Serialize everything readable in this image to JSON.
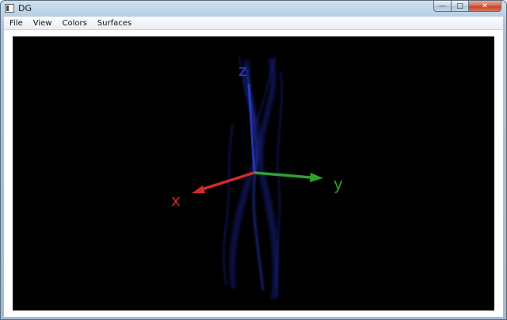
{
  "window": {
    "title": "DG"
  },
  "caption_buttons": {
    "minimize": "—",
    "maximize": "□",
    "close": "✕"
  },
  "menu": {
    "items": [
      {
        "label": "File"
      },
      {
        "label": "View"
      },
      {
        "label": "Colors"
      },
      {
        "label": "Surfaces"
      }
    ]
  },
  "viewport": {
    "background": "#000000",
    "axes": {
      "x": {
        "label": "x",
        "color": "#d42a2a"
      },
      "y": {
        "label": "y",
        "color": "#2fa12f"
      },
      "z": {
        "label": "z",
        "color": "#2f3fd0"
      }
    },
    "surface_color": "#1d2bbf"
  }
}
